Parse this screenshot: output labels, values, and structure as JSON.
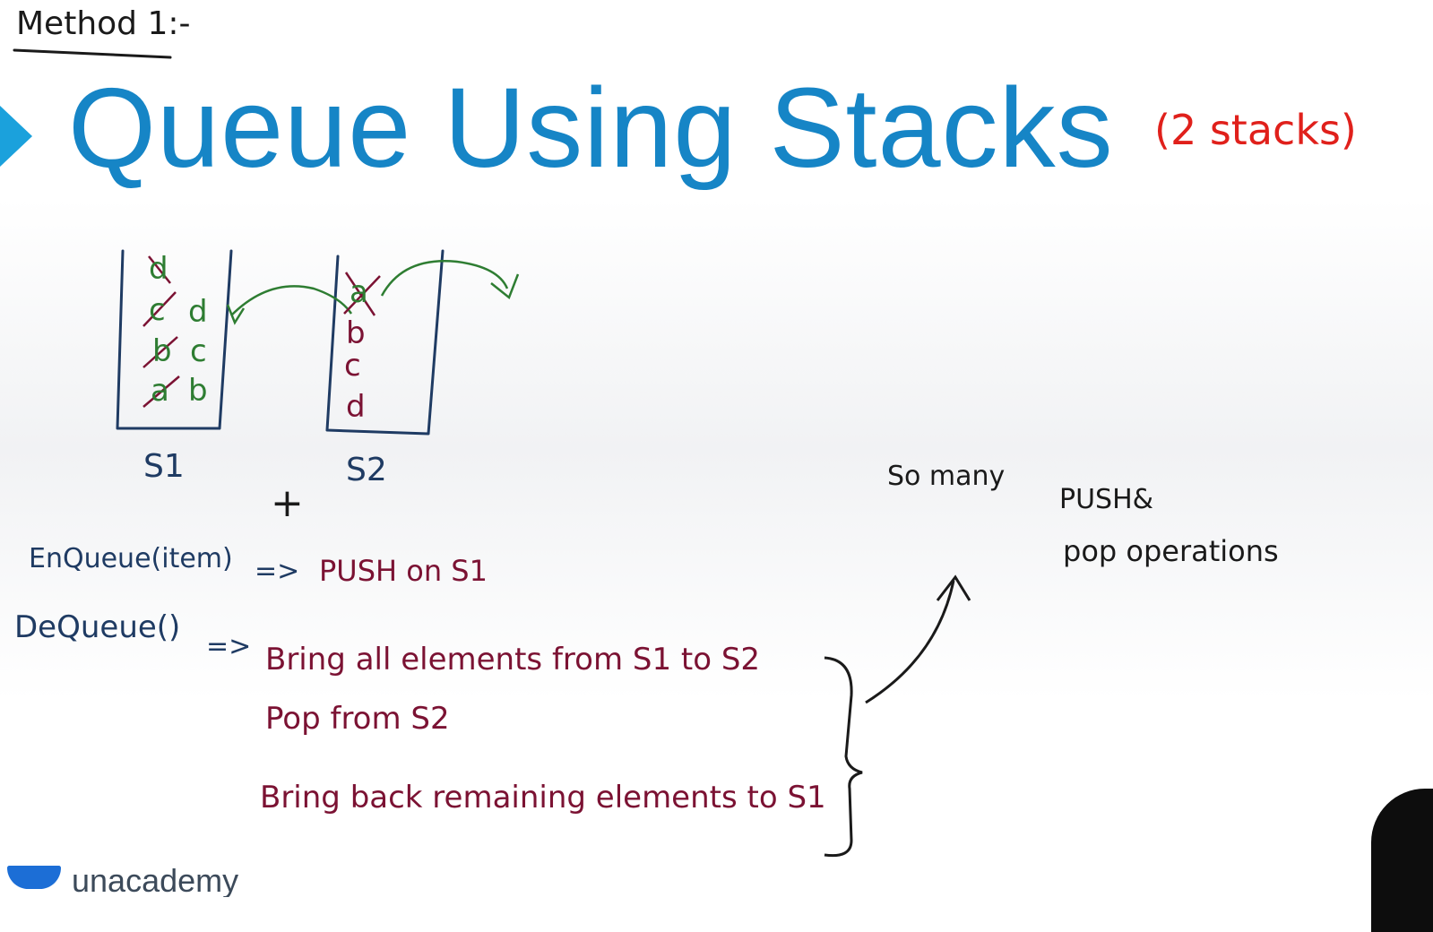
{
  "method_label": "Method 1:-",
  "title": "Queue Using Stacks",
  "subtitle_note": "(2 stacks)",
  "stacks": [
    {
      "name": "S1",
      "crossed": [
        "d",
        "c",
        "b",
        "a"
      ],
      "kept": [
        "d",
        "c",
        "b"
      ]
    },
    {
      "name": "S2",
      "crossed": [
        "a"
      ],
      "kept": [
        "b",
        "c",
        "d"
      ]
    }
  ],
  "plus_sign": "+",
  "enqueue": {
    "label": "EnQueue(item)",
    "arrow": "=>",
    "action": "PUSH on S1"
  },
  "dequeue": {
    "label": "DeQueue()",
    "arrow": "=>",
    "steps": [
      "Bring all elements from S1 to S2",
      "Pop from S2",
      "Bring back remaining elements to S1"
    ]
  },
  "note": {
    "line1_a": "So many",
    "line1_b": "PUSH&",
    "line2": "pop operations"
  },
  "brand": {
    "name": "unacademy"
  },
  "colors": {
    "title": "#1685c6",
    "title_marker": "#1ba1dc",
    "annotation_red": "#e0201b",
    "ink_green": "#2e7d32",
    "ink_maroon": "#7b1233",
    "ink_navy": "#1f3b63",
    "ink_black": "#1a1a1a"
  }
}
